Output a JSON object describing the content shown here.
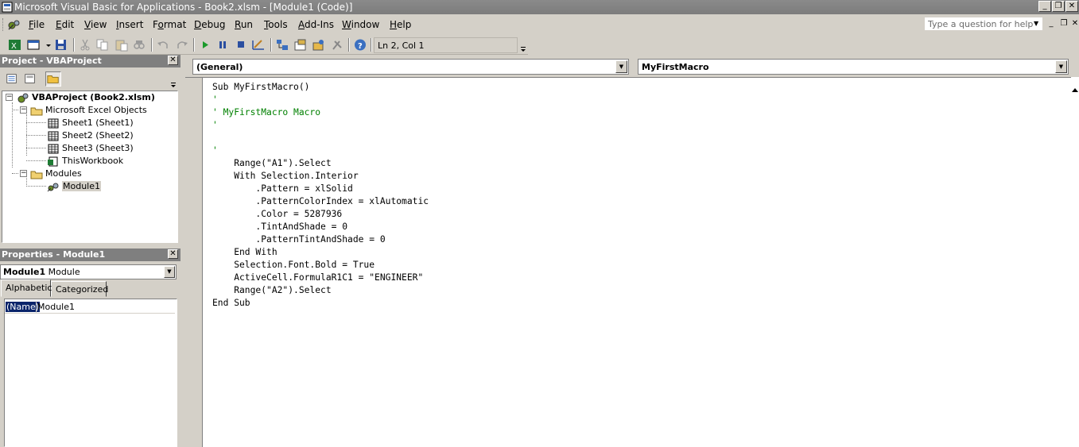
{
  "window": {
    "title": "Microsoft Visual Basic for Applications - Book2.xlsm - [Module1 (Code)]",
    "min_glyph": "_",
    "restore_glyph": "❐",
    "close_glyph": "✕"
  },
  "menu": {
    "items": [
      {
        "pre": "",
        "u": "F",
        "post": "ile"
      },
      {
        "pre": "",
        "u": "E",
        "post": "dit"
      },
      {
        "pre": "",
        "u": "V",
        "post": "iew"
      },
      {
        "pre": "",
        "u": "I",
        "post": "nsert"
      },
      {
        "pre": "F",
        "u": "o",
        "post": "rmat"
      },
      {
        "pre": "",
        "u": "D",
        "post": "ebug"
      },
      {
        "pre": "",
        "u": "R",
        "post": "un"
      },
      {
        "pre": "",
        "u": "T",
        "post": "ools"
      },
      {
        "pre": "",
        "u": "A",
        "post": "dd-Ins"
      },
      {
        "pre": "",
        "u": "W",
        "post": "indow"
      },
      {
        "pre": "",
        "u": "H",
        "post": "elp"
      }
    ],
    "help_placeholder": "Type a question for help"
  },
  "toolbar": {
    "position": "Ln 2, Col 1"
  },
  "project": {
    "title": "Project - VBAProject",
    "tree": {
      "root": "VBAProject (Book2.xlsm)",
      "excel_objects": "Microsoft Excel Objects",
      "sheet1": "Sheet1 (Sheet1)",
      "sheet2": "Sheet2 (Sheet2)",
      "sheet3": "Sheet3 (Sheet3)",
      "thisworkbook": "ThisWorkbook",
      "modules": "Modules",
      "module1": "Module1"
    }
  },
  "properties": {
    "title": "Properties - Module1",
    "object_name": "Module1",
    "object_type": "Module",
    "tabs": [
      "Alphabetic",
      "Categorized"
    ],
    "prop_name": "(Name)",
    "prop_value": "Module1"
  },
  "code": {
    "object_combo": "(General)",
    "proc_combo": "MyFirstMacro",
    "lines": [
      {
        "text": "Sub MyFirstMacro()",
        "kind": "code"
      },
      {
        "text": "'",
        "kind": "comment"
      },
      {
        "text": "' MyFirstMacro Macro",
        "kind": "comment"
      },
      {
        "text": "'",
        "kind": "comment"
      },
      {
        "text": "",
        "kind": "code"
      },
      {
        "text": "'",
        "kind": "comment"
      },
      {
        "text": "    Range(\"A1\").Select",
        "kind": "code"
      },
      {
        "text": "    With Selection.Interior",
        "kind": "code"
      },
      {
        "text": "        .Pattern = xlSolid",
        "kind": "code"
      },
      {
        "text": "        .PatternColorIndex = xlAutomatic",
        "kind": "code"
      },
      {
        "text": "        .Color = 5287936",
        "kind": "code"
      },
      {
        "text": "        .TintAndShade = 0",
        "kind": "code"
      },
      {
        "text": "        .PatternTintAndShade = 0",
        "kind": "code"
      },
      {
        "text": "    End With",
        "kind": "code"
      },
      {
        "text": "    Selection.Font.Bold = True",
        "kind": "code"
      },
      {
        "text": "    ActiveCell.FormulaR1C1 = \"ENGINEER\"",
        "kind": "code"
      },
      {
        "text": "    Range(\"A2\").Select",
        "kind": "code"
      },
      {
        "text": "End Sub",
        "kind": "code"
      }
    ]
  },
  "icons": {
    "close_glyph": "✕",
    "dropdown_glyph": "▼",
    "expand_glyph": "−"
  },
  "colors": {
    "comment": "#008000",
    "selection": "#0a246a",
    "titlebar": "#7f7f7f"
  }
}
